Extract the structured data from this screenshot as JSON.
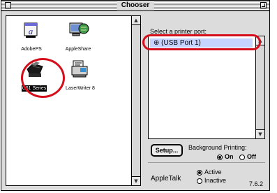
{
  "window": {
    "title": "Chooser"
  },
  "drivers": [
    {
      "label": "AdobePS",
      "icon": "adobe-ps-icon",
      "selected": false
    },
    {
      "label": "AppleShare",
      "icon": "appleshare-icon",
      "selected": false
    },
    {
      "label": "C61 Series",
      "icon": "printer-icon",
      "selected": true
    },
    {
      "label": "LaserWriter 8",
      "icon": "laserwriter-icon",
      "selected": false
    }
  ],
  "port": {
    "label": "Select a printer port:",
    "items": [
      {
        "label": "(USB Port 1)",
        "icon": "usb-icon",
        "selected": true
      }
    ]
  },
  "setup": {
    "label": "Setup..."
  },
  "background_printing": {
    "label": "Background Printing:",
    "on_label": "On",
    "off_label": "Off",
    "value": "On"
  },
  "appletalk": {
    "label": "AppleTalk",
    "active_label": "Active",
    "inactive_label": "Inactive",
    "value": "Active"
  },
  "version": "7.6.2",
  "colors": {
    "highlight": "#d40f1b",
    "selection": "#c7d3ff"
  }
}
